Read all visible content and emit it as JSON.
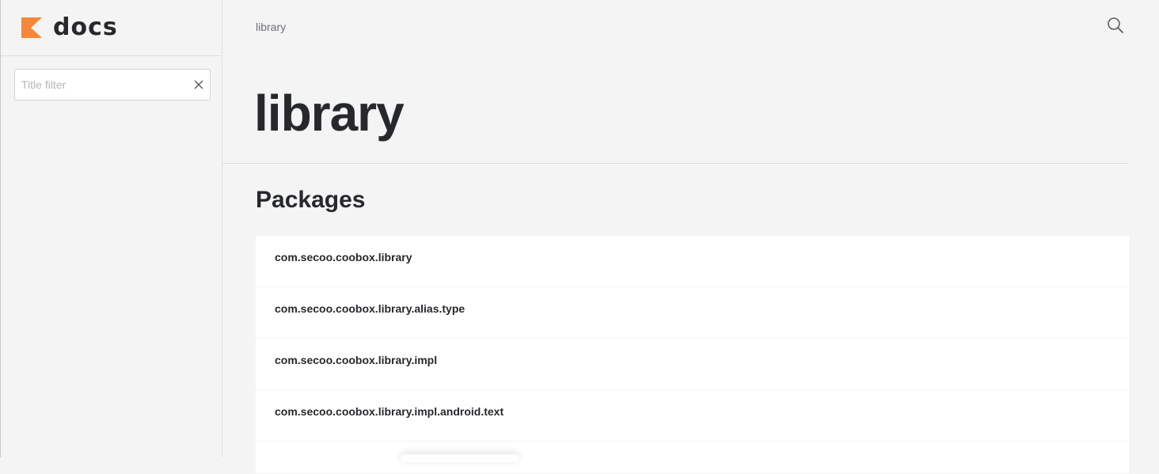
{
  "app": {
    "logo_text": "docs",
    "logo_icon": "kotlin-k-logo",
    "brand_color": "#f78739"
  },
  "sidebar": {
    "filter": {
      "value": "",
      "placeholder": "Title filter",
      "clear_icon": "close-icon"
    }
  },
  "header": {
    "breadcrumb": "library",
    "search_icon": "search-icon"
  },
  "main": {
    "title": "library",
    "section_title": "Packages",
    "packages": [
      "com.secoo.coobox.library",
      "com.secoo.coobox.library.alias.type",
      "com.secoo.coobox.library.impl",
      "com.secoo.coobox.library.impl.android.text"
    ]
  }
}
